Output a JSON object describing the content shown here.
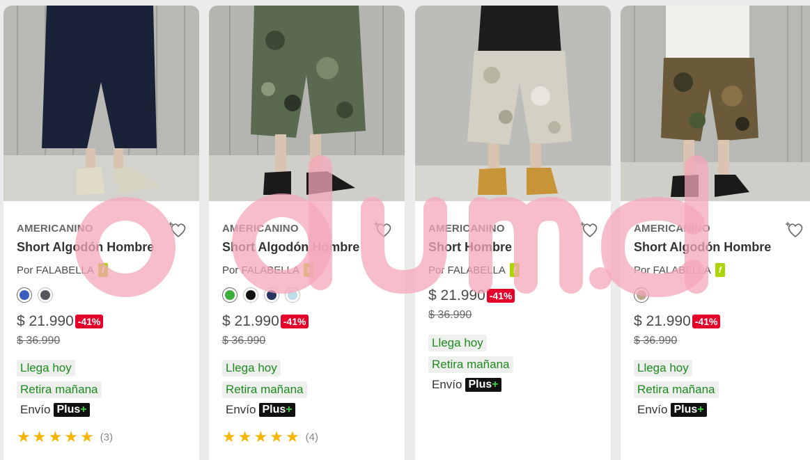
{
  "products": [
    {
      "brand": "AMERICANINO",
      "title": "Short Algodón Hombre",
      "seller": "Por FALABELLA",
      "swatches": [
        "#3a5dbb",
        "#55565e"
      ],
      "price": "$ 21.990",
      "discount": "-41%",
      "old_price": "$ 36.990",
      "delivery": [
        "Llega hoy",
        "Retira mañana"
      ],
      "envio": "Envío",
      "plus": "Plus",
      "rating_count": "(3)"
    },
    {
      "brand": "AMERICANINO",
      "title": "Short Algodón Hombre",
      "seller": "Por FALABELLA",
      "swatches": [
        "#3cae3c",
        "#111111",
        "#283560",
        "#bcdce8"
      ],
      "price": "$ 21.990",
      "discount": "-41%",
      "old_price": "$ 36.990",
      "delivery": [
        "Llega hoy",
        "Retira mañana"
      ],
      "envio": "Envío",
      "plus": "Plus",
      "rating_count": "(4)"
    },
    {
      "brand": "AMERICANINO",
      "title": "Short Hombre",
      "seller": "Por FALABELLA",
      "price": "$ 21.990",
      "discount": "-41%",
      "old_price": "$ 36.990",
      "delivery": [
        "Llega hoy",
        "Retira mañana"
      ],
      "envio": "Envío",
      "plus": "Plus"
    },
    {
      "brand": "AMERICANINO",
      "title": "Short Algodón Hombre",
      "seller": "Por FALABELLA",
      "swatches": [
        "#b9a88a"
      ],
      "price": "$ 21.990",
      "discount": "-41%",
      "old_price": "$ 36.990",
      "delivery": [
        "Llega hoy",
        "Retira mañana"
      ],
      "envio": "Envío",
      "plus": "Plus"
    }
  ],
  "plus_symbol": "+",
  "seller_badge": "f",
  "watermark": "odum.cl",
  "colors": {
    "discount": "#e4002b",
    "delivery_green": "#1e8a1e",
    "star": "#f7b500",
    "seller_badge": "#aad500",
    "watermark": "#f4a7b9"
  }
}
